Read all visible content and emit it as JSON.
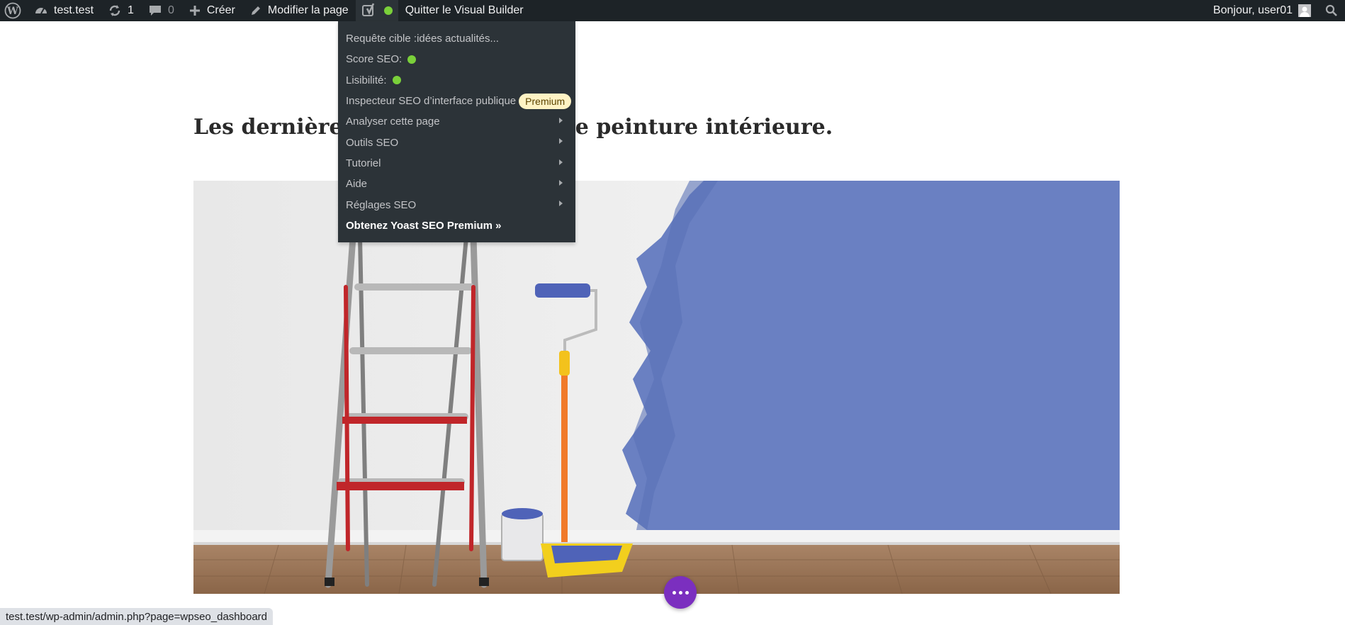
{
  "admin_bar": {
    "site_name": "test.test",
    "updates_count": "1",
    "comments_count": "0",
    "create_label": "Créer",
    "edit_page_label": "Modifier la page",
    "visual_builder_label": "Quitter le Visual Builder",
    "greeting": "Bonjour, user01"
  },
  "seo_menu": {
    "items": [
      {
        "label": "Requête cible :idées actualités..."
      },
      {
        "label": "Score SEO:"
      },
      {
        "label": "Lisibilité:"
      },
      {
        "label": "Inspecteur SEO d’interface publique",
        "badge": "Premium"
      },
      {
        "label": "Analyser cette page"
      },
      {
        "label": "Outils SEO"
      },
      {
        "label": "Tutoriel"
      },
      {
        "label": "Aide"
      },
      {
        "label": "Réglages SEO"
      },
      {
        "label": "Obtenez Yoast SEO Premium »"
      }
    ],
    "status_color": "#7ad03a"
  },
  "page": {
    "heading_start": "Les dernières",
    "heading_end": "re de peinture intérieure."
  },
  "status_url": "test.test/wp-admin/admin.php?page=wpseo_dashboard",
  "colors": {
    "admin_bar_bg": "#1d2327",
    "dropdown_bg": "#2c3338",
    "premium_badge": "#fff3c4",
    "fab": "#7b2fbf",
    "wall_paint": "#6a80c2"
  }
}
